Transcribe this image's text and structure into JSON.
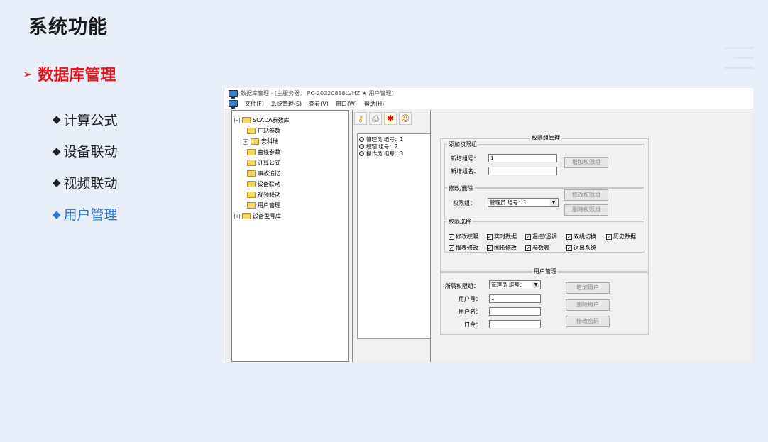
{
  "slide": {
    "title": "系统功能",
    "section_title": "数据库管理",
    "bullets": [
      "计算公式",
      "设备联动",
      "视频联动",
      "用户管理"
    ],
    "active_bullet_color": "#2c78d0",
    "section_color": "#e8141e"
  },
  "app": {
    "title": "数据库管理 - [主服务器： PC-20220818LVHZ ★ 用户管理]",
    "menu": [
      "文件(F)",
      "系统管理(S)",
      "查看(V)",
      "窗口(W)",
      "帮助(H)"
    ],
    "toolbar_icons": [
      "key-icon",
      "printer-icon",
      "run-icon",
      "smiley-icon"
    ],
    "tree": {
      "root": "SCADA参数库",
      "children": [
        "厂站参数",
        "安科瑞",
        "曲线参数",
        "计算公式",
        "事故追忆",
        "设备联动",
        "视频联动",
        "用户管理"
      ],
      "sibling": "设备型号库"
    },
    "groups_list": [
      "管理员 组号：1",
      "经理 组号：2",
      "操作员 组号：3"
    ],
    "perm_group_mgmt": {
      "title": "权限组管理",
      "add": {
        "title": "添加权限组",
        "new_no_label": "新增组号：",
        "new_no_value": "1",
        "new_name_label": "新增组名：",
        "new_name_value": "",
        "add_button": "增加权限组"
      },
      "modify": {
        "title": "修改/删除",
        "group_label": "权限组：",
        "group_value": "管理员 组号：1",
        "modify_button": "修改权限组",
        "delete_button": "删除权限组"
      },
      "perms": {
        "title": "权限选择",
        "row1": [
          "修改权限",
          "实时数据",
          "遥控/遥调",
          "双机切换",
          "历史数据"
        ],
        "row2": [
          "报表修改",
          "图形修改",
          "参数表",
          "退出系统"
        ]
      }
    },
    "user_mgmt": {
      "title": "用户管理",
      "group_label": "所属权限组：",
      "group_value": "管理员 组号：",
      "user_no_label": "用户号：",
      "user_no_value": "1",
      "user_name_label": "用户名：",
      "password_label": "口令：",
      "add_button": "增加用户",
      "delete_button": "删除用户",
      "change_pw_button": "修改密码"
    }
  }
}
